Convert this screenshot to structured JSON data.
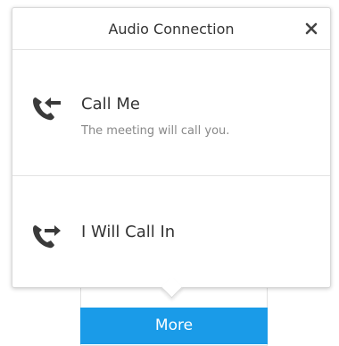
{
  "dialog": {
    "title": "Audio Connection",
    "close_icon": "close-icon"
  },
  "options": [
    {
      "label": "Call Me",
      "sublabel": "The meeting will call you.",
      "icon": "phone-incoming-icon"
    },
    {
      "label": "I Will Call In",
      "icon": "phone-outgoing-icon"
    }
  ],
  "footer": {
    "more_label": "More"
  },
  "colors": {
    "accent": "#1a9be8",
    "text": "#333333",
    "subtext": "#888888"
  }
}
